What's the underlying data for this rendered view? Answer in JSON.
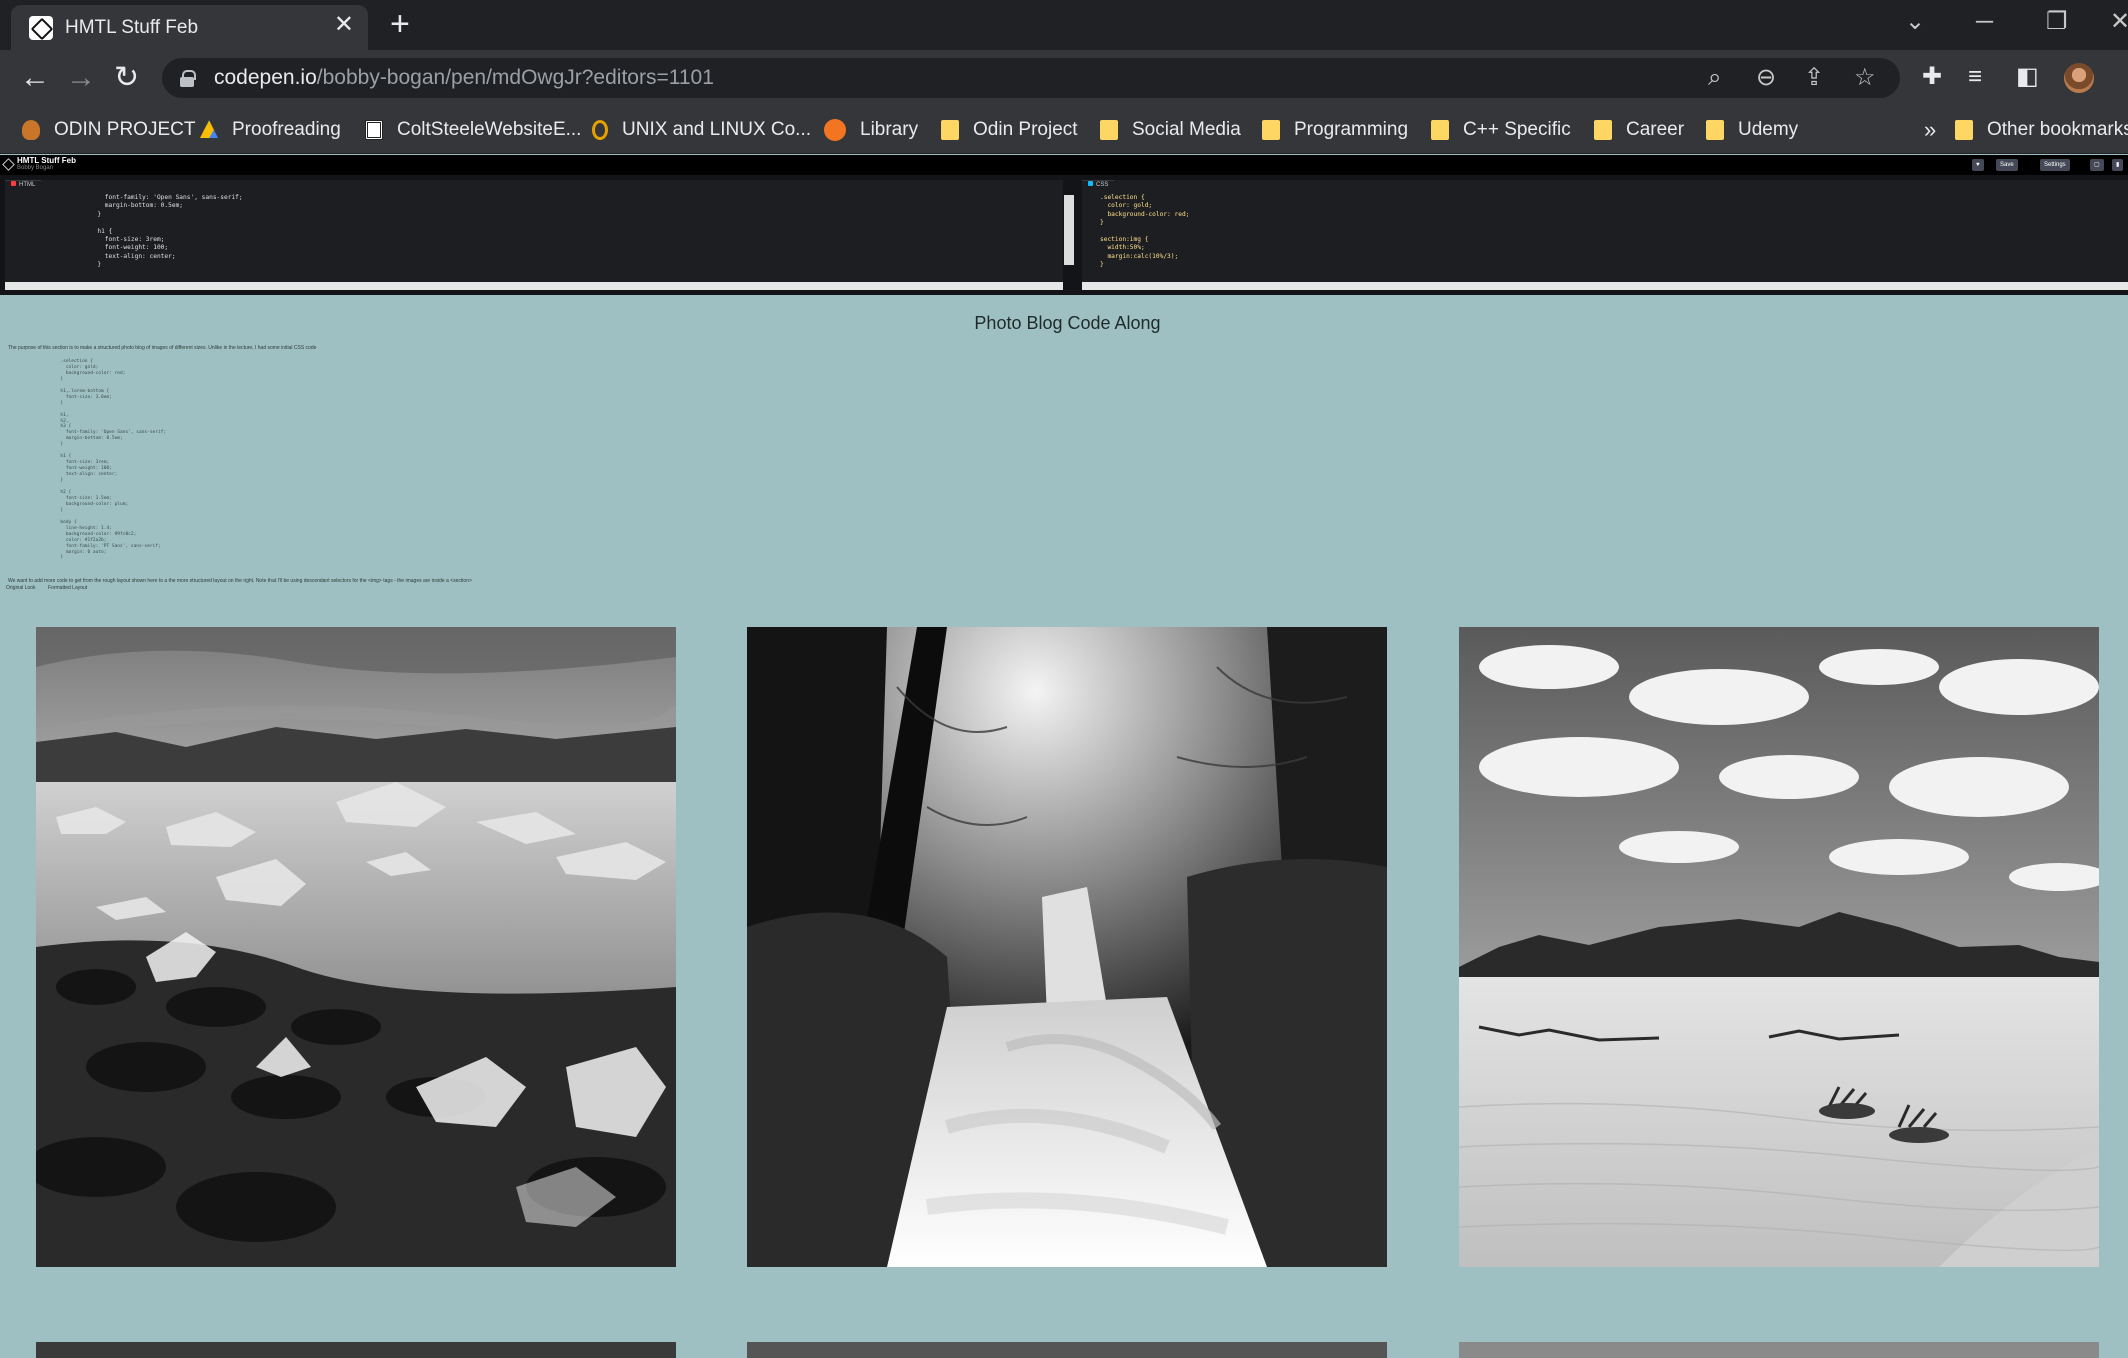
{
  "browser": {
    "tab_title": "HMTL Stuff Feb",
    "url_host": "codepen.io",
    "url_path": "/bobby-bogan/pen/mdOwgJr?editors=1101",
    "bookmarks": [
      {
        "label": "ODIN PROJECT",
        "icon": "odin-icon"
      },
      {
        "label": "Proofreading",
        "icon": "google-drive-icon"
      },
      {
        "label": "ColtSteeleWebsiteE...",
        "icon": "colt-steele-icon"
      },
      {
        "label": "UNIX and LINUX Co...",
        "icon": "unix-icon"
      },
      {
        "label": "Library",
        "icon": "library-icon"
      },
      {
        "label": "Odin Project",
        "icon": "folder-icon"
      },
      {
        "label": "Social Media",
        "icon": "folder-icon"
      },
      {
        "label": "Programming",
        "icon": "folder-icon"
      },
      {
        "label": "C++ Specific",
        "icon": "folder-icon"
      },
      {
        "label": "Career",
        "icon": "folder-icon"
      },
      {
        "label": "Udemy",
        "icon": "folder-icon"
      }
    ],
    "bookmarks_overflow": "»",
    "other_bookmarks": "Other bookmarks"
  },
  "codepen": {
    "pen_title": "HMTL Stuff Feb",
    "author": "Bobby Bogan",
    "save_label": "Save",
    "settings_label": "Settings",
    "html_tab": "HTML",
    "css_tab": "CSS",
    "html_code": "        font-family: 'Open Sans', sans-serif;\n        margin-bottom: 0.5em;\n      }\n\n      h1 {\n        font-size: 3rem;\n        font-weight: 100;\n        text-align: center;\n      }",
    "css_code": ".selection {\n  color: gold;\n  background-color: red;\n}\n\nsection:img {\n  width:50%;\n  margin:calc(10%/3);\n}"
  },
  "page": {
    "title": "Photo Blog Code Along",
    "intro": "The purpose of this section is to make a structured photo blog of images of different sizes. Unlike in the lecture, I had some initial CSS code",
    "css_sample": "  .selection {\n    color: gold;\n    background-color: red;\n  }\n\n  h1,.lorem-bottom {\n    font-size: 3.0em;\n  }\n\n  h1,\n  h2,\n  h3 {\n    font-family: 'Open Sans', sans-serif;\n    margin-bottom: 0.5em;\n  }\n\n  h1 {\n    font-size: 3rem;\n    font-weight: 100;\n    text-align: center;\n  }\n\n  h2 {\n    font-size: 1.5em;\n    background-color: plum;\n  }\n\n  body {\n    line-height: 1.4;\n    background-color: #9fc0c2;\n    color: #1f2a2b;\n    font-family: 'PT Sans', sans-serif;\n    margin: 0 auto;\n  }",
    "followup": "We want to add more code to get from the rough layout shown here to a the more structured layout on the right. Note that I'll be using descendant selectors for the <img> tags - the images are inside a <section>",
    "caption_left": "Original Look",
    "caption_right": "Formatted Layout",
    "photos": [
      {
        "subject": "glacier-lagoon-ice"
      },
      {
        "subject": "forest-waterfall"
      },
      {
        "subject": "desert-dunes-mountains"
      }
    ]
  }
}
